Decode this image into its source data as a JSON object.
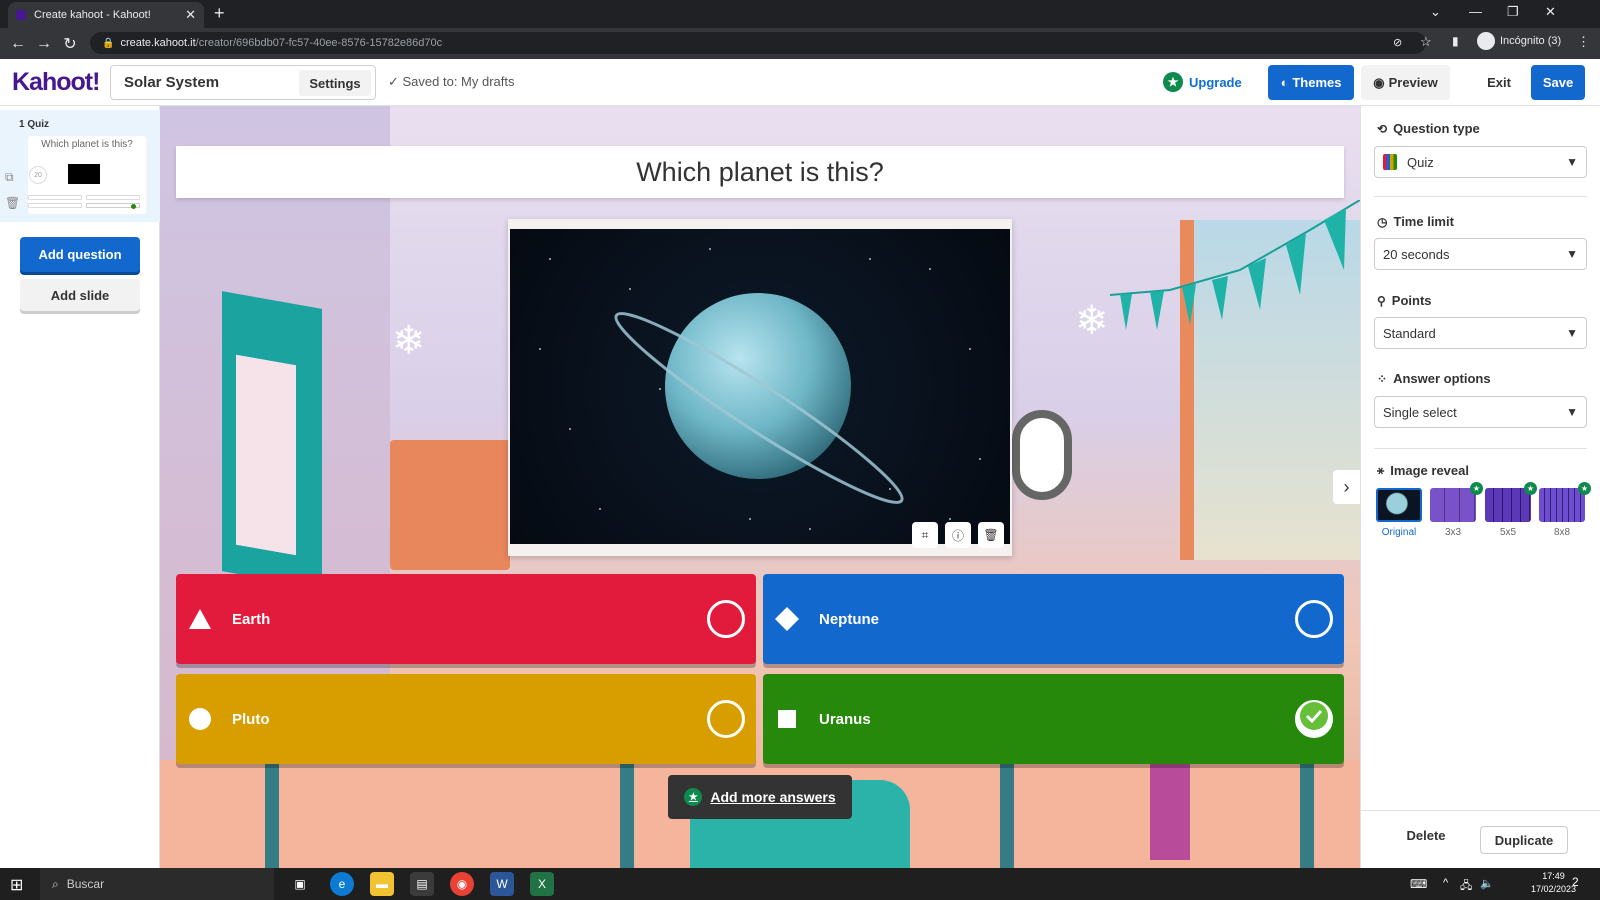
{
  "browser": {
    "tab_title": "Create kahoot - Kahoot!",
    "tab_close": "✕",
    "new_tab": "+",
    "url_host": "create.kahoot.it",
    "url_path": "/creator/696bdb07-fc57-40ee-8576-15782e86d70c",
    "incognito_label": "Incógnito (3)"
  },
  "header": {
    "logo": "Kahoot!",
    "kahoot_title": "Solar System",
    "settings_label": "Settings",
    "saved_status": "✓  Saved to: My drafts",
    "upgrade_label": "Upgrade",
    "themes_label": "Themes",
    "preview_label": "Preview",
    "exit_label": "Exit",
    "save_label": "Save"
  },
  "sidebar": {
    "slide_label": "1  Quiz",
    "thumb_question": "Which planet is this?",
    "thumb_timer": "20",
    "add_question": "Add question",
    "add_slide": "Add slide"
  },
  "question": {
    "title": "Which planet is this?"
  },
  "answers": [
    {
      "text": "Earth",
      "shape": "triangle",
      "color": "#e21b3c",
      "correct": false
    },
    {
      "text": "Neptune",
      "shape": "diamond",
      "color": "#1368ce",
      "correct": false
    },
    {
      "text": "Pluto",
      "shape": "circle",
      "color": "#d89e00",
      "correct": false
    },
    {
      "text": "Uranus",
      "shape": "square",
      "color": "#26890c",
      "correct": true
    }
  ],
  "add_more_answers": "Add more answers",
  "right_panel": {
    "question_type_label": "Question type",
    "question_type_value": "Quiz",
    "time_limit_label": "Time limit",
    "time_limit_value": "20 seconds",
    "points_label": "Points",
    "points_value": "Standard",
    "answer_options_label": "Answer options",
    "answer_options_value": "Single select",
    "image_reveal_label": "Image reveal",
    "reveal_options": [
      "Original",
      "3x3",
      "5x5",
      "8x8"
    ],
    "reveal_selected": "Original",
    "delete_label": "Delete",
    "duplicate_label": "Duplicate"
  },
  "taskbar": {
    "search_placeholder": "Buscar",
    "time": "17:49",
    "date": "17/02/2023",
    "notification_count": "2"
  },
  "colors": {
    "brand_purple": "#46178f",
    "primary_blue": "#1368ce",
    "upgrade_green": "#0e8a4f"
  }
}
